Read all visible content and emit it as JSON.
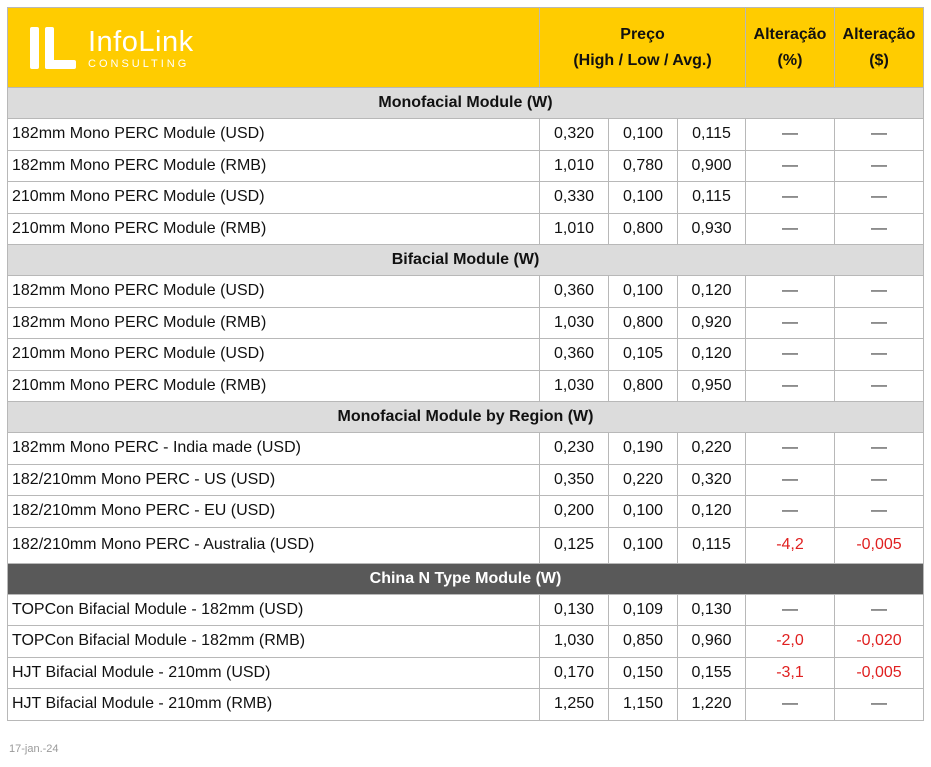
{
  "brand": {
    "name": "InfoLink",
    "sub": "CONSULTING"
  },
  "header": {
    "price_title": "Preço",
    "price_subtitle": "(High / Low / Avg.)",
    "change_pct_title": "Alteração",
    "change_pct_unit": "(%)",
    "change_abs_title": "Alteração",
    "change_abs_unit": "($)"
  },
  "sections": [
    {
      "title": "Monofacial Module (W)",
      "style": "light",
      "rows": [
        {
          "name": "182mm  Mono PERC Module (USD)",
          "high": "0,320",
          "low": "0,100",
          "avg": "0,115",
          "pct": "—",
          "abs": "—"
        },
        {
          "name": "182mm  Mono PERC Module (RMB)",
          "high": "1,010",
          "low": "0,780",
          "avg": "0,900",
          "pct": "—",
          "abs": "—"
        },
        {
          "name": "210mm  Mono PERC Module (USD)",
          "high": "0,330",
          "low": "0,100",
          "avg": "0,115",
          "pct": "—",
          "abs": "—"
        },
        {
          "name": "210mm  Mono PERC Module (RMB)",
          "high": "1,010",
          "low": "0,800",
          "avg": "0,930",
          "pct": "—",
          "abs": "—"
        }
      ]
    },
    {
      "title": "Bifacial Module (W)",
      "style": "light",
      "rows": [
        {
          "name": "182mm  Mono PERC Module (USD)",
          "high": "0,360",
          "low": "0,100",
          "avg": "0,120",
          "pct": "—",
          "abs": "—"
        },
        {
          "name": "182mm  Mono PERC Module (RMB)",
          "high": "1,030",
          "low": "0,800",
          "avg": "0,920",
          "pct": "—",
          "abs": "—"
        },
        {
          "name": "210mm  Mono PERC Module (USD)",
          "high": "0,360",
          "low": "0,105",
          "avg": "0,120",
          "pct": "—",
          "abs": "—"
        },
        {
          "name": "210mm  Mono PERC Module (RMB)",
          "high": "1,030",
          "low": "0,800",
          "avg": "0,950",
          "pct": "—",
          "abs": "—"
        }
      ]
    },
    {
      "title": "Monofacial Module by Region (W)",
      "style": "light",
      "rows": [
        {
          "name": "182mm Mono PERC - India made (USD)",
          "high": "0,230",
          "low": "0,190",
          "avg": "0,220",
          "pct": "—",
          "abs": "—"
        },
        {
          "name": "182/210mm Mono PERC - US (USD)",
          "high": "0,350",
          "low": "0,220",
          "avg": "0,320",
          "pct": "—",
          "abs": "—"
        },
        {
          "name": "182/210mm Mono PERC - EU (USD)",
          "high": "0,200",
          "low": "0,100",
          "avg": "0,120",
          "pct": "—",
          "abs": "—"
        },
        {
          "name": "182/210mm Mono PERC - Australia (USD)",
          "high": "0,125",
          "low": "0,100",
          "avg": "0,115",
          "pct": "-4,2",
          "abs": "-0,005",
          "tall": true
        }
      ]
    },
    {
      "title": "China N Type Module (W)",
      "style": "dark",
      "rows": [
        {
          "name": "TOPCon Bifacial Module - 182mm (USD)",
          "high": "0,130",
          "low": "0,109",
          "avg": "0,130",
          "pct": "—",
          "abs": "—"
        },
        {
          "name": "TOPCon Bifacial Module - 182mm (RMB)",
          "high": "1,030",
          "low": "0,850",
          "avg": "0,960",
          "pct": "-2,0",
          "abs": "-0,020"
        },
        {
          "name": "HJT Bifacial Module - 210mm (USD)",
          "high": "0,170",
          "low": "0,150",
          "avg": "0,155",
          "pct": "-3,1",
          "abs": "-0,005"
        },
        {
          "name": "HJT Bifacial Module - 210mm (RMB)",
          "high": "1,250",
          "low": "1,150",
          "avg": "1,220",
          "pct": "—",
          "abs": "—"
        }
      ]
    }
  ],
  "colors": {
    "header": "#ffcc00",
    "section_light": "#dcdcdc",
    "section_dark": "#595959",
    "negative": "#e02020"
  },
  "footer": {
    "date": "17-jan.-24"
  }
}
